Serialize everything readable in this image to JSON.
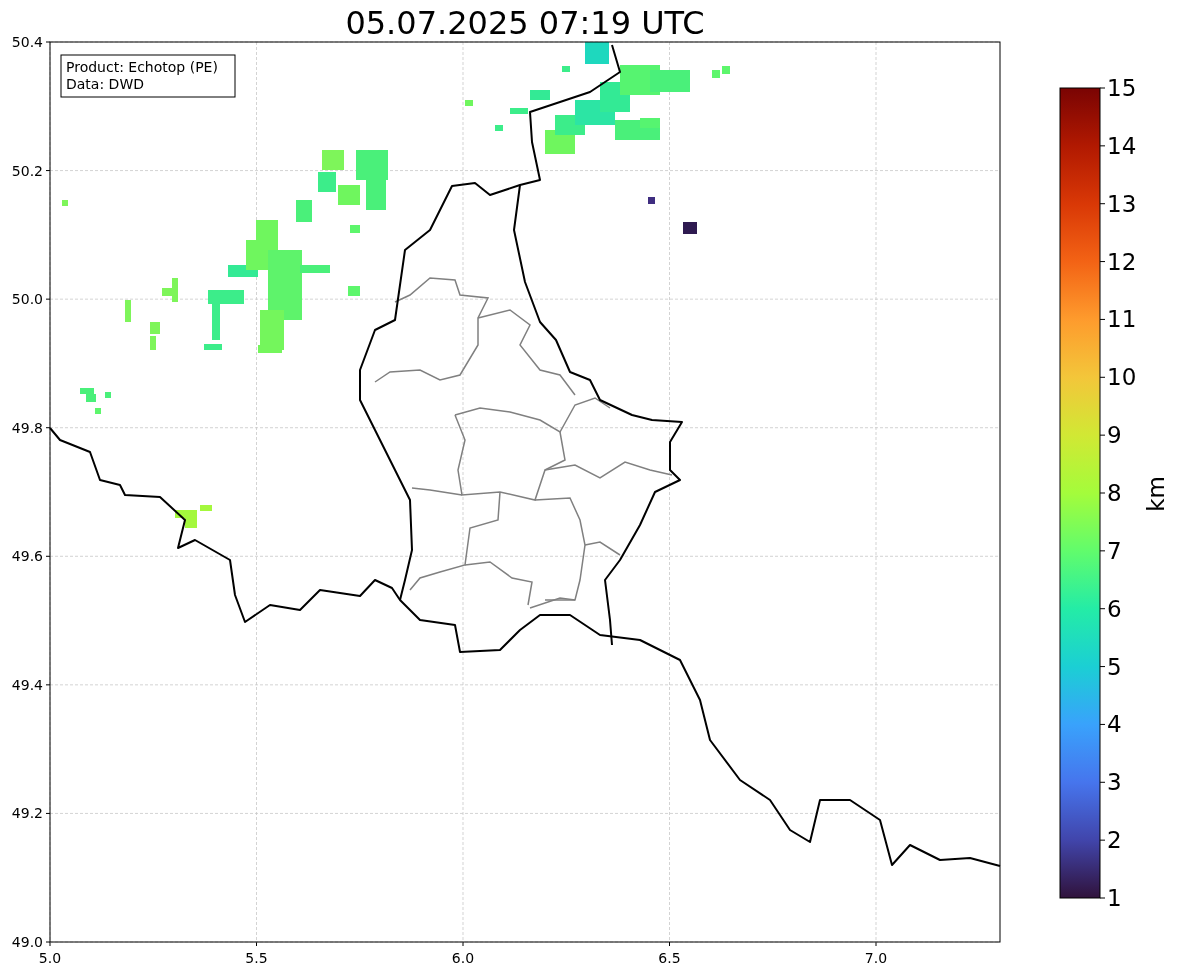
{
  "title": "05.07.2025 07:19 UTC",
  "info_box": [
    "Product: Echotop (PE)",
    "Data: DWD"
  ],
  "axes": {
    "x_tick_labels": [
      "5.0",
      "5.5",
      "6.0",
      "6.5",
      "7.0"
    ],
    "y_tick_labels": [
      "50.4",
      "50.2",
      "50.0",
      "49.8",
      "49.6",
      "49.4",
      "49.2",
      "49.0"
    ]
  },
  "colorbar": {
    "label": "km",
    "tick_labels": [
      "15",
      "14",
      "13",
      "12",
      "11",
      "10",
      "9",
      "8",
      "7",
      "6",
      "5",
      "4",
      "3",
      "2",
      "1"
    ]
  }
}
